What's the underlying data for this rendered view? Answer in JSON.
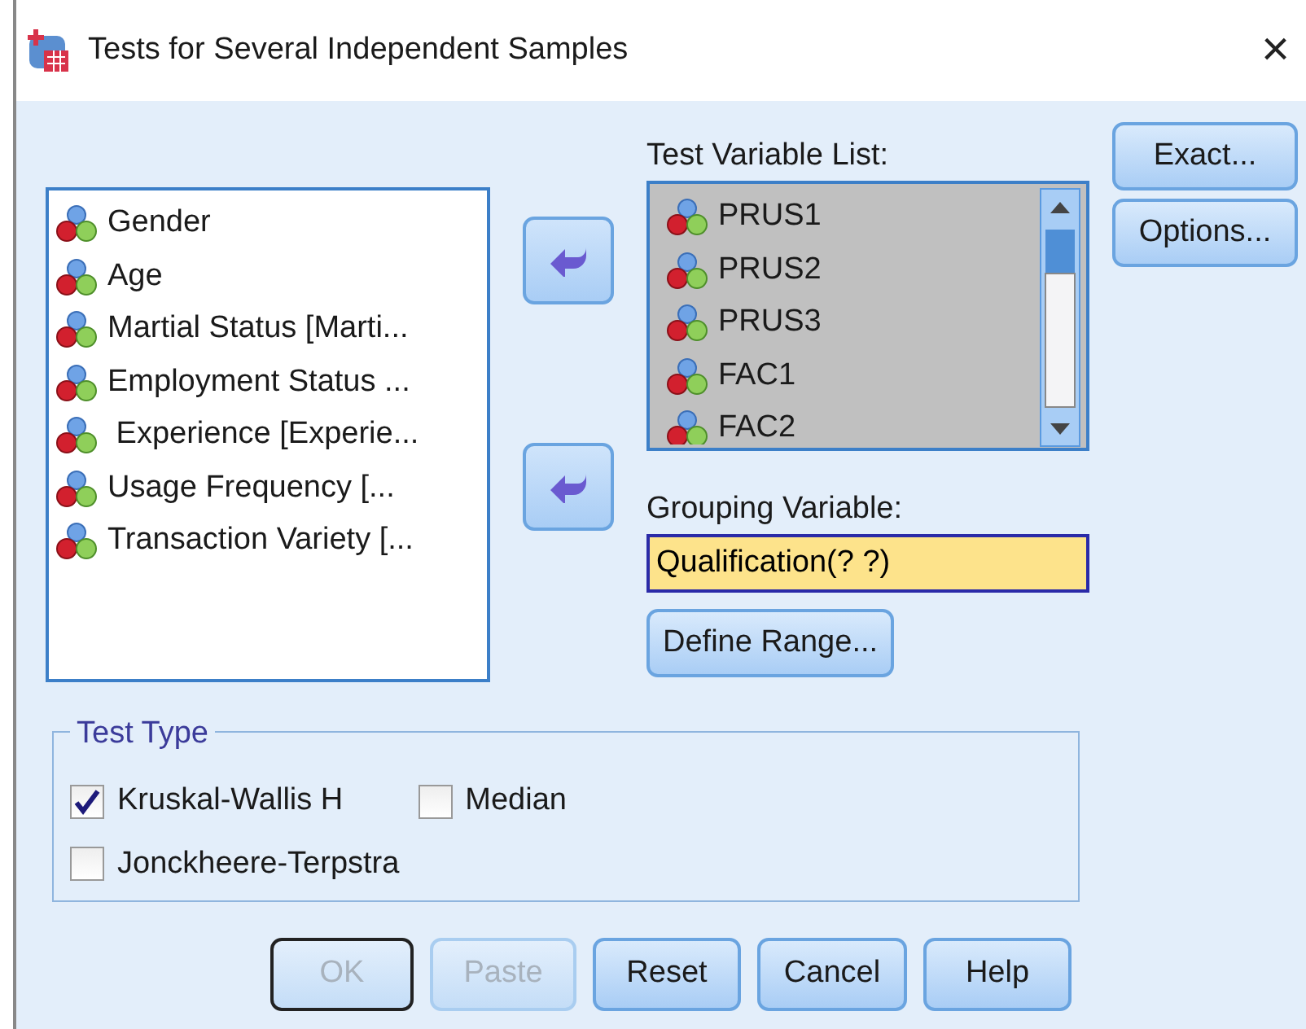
{
  "window": {
    "title": "Tests for Several Independent Samples",
    "close": "×"
  },
  "source_list": {
    "items": [
      {
        "label": "Gender"
      },
      {
        "label": "Age"
      },
      {
        "label": "Martial Status [Marti..."
      },
      {
        "label": "Employment Status ..."
      },
      {
        "label": " Experience [Experie..."
      },
      {
        "label": "Usage Frequency [..."
      },
      {
        "label": "Transaction Variety [..."
      }
    ]
  },
  "test_variable_list": {
    "label": "Test Variable List:",
    "items": [
      {
        "label": "PRUS1"
      },
      {
        "label": "PRUS2"
      },
      {
        "label": "PRUS3"
      },
      {
        "label": "FAC1"
      },
      {
        "label": "FAC2"
      }
    ]
  },
  "grouping_variable": {
    "label": "Grouping Variable:",
    "value": "Qualification(? ?)",
    "define_range": {
      "label": "Define Range..."
    }
  },
  "side_buttons": [
    {
      "label": "Exact..."
    },
    {
      "label": "Options..."
    }
  ],
  "test_type": {
    "title": "Test Type",
    "options": [
      {
        "label": "Kruskal-Wallis H",
        "checked": true
      },
      {
        "label": "Median",
        "checked": false
      },
      {
        "label": "Jonckheere-Terpstra",
        "checked": false
      }
    ]
  },
  "buttons": [
    {
      "label": "OK",
      "disabled": true,
      "default": true
    },
    {
      "label": "Paste",
      "disabled": true,
      "default": false
    },
    {
      "label": "Reset",
      "disabled": false,
      "default": false
    },
    {
      "label": "Cancel",
      "disabled": false,
      "default": false
    },
    {
      "label": "Help",
      "disabled": false,
      "default": false
    }
  ]
}
